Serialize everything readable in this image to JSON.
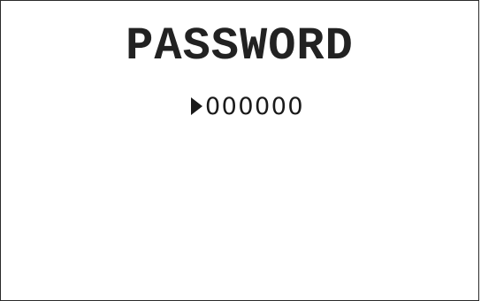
{
  "screen": {
    "title": "PASSWORD",
    "password_entry": {
      "value": "000000",
      "cursor_icon": "triangle-right-icon"
    }
  }
}
